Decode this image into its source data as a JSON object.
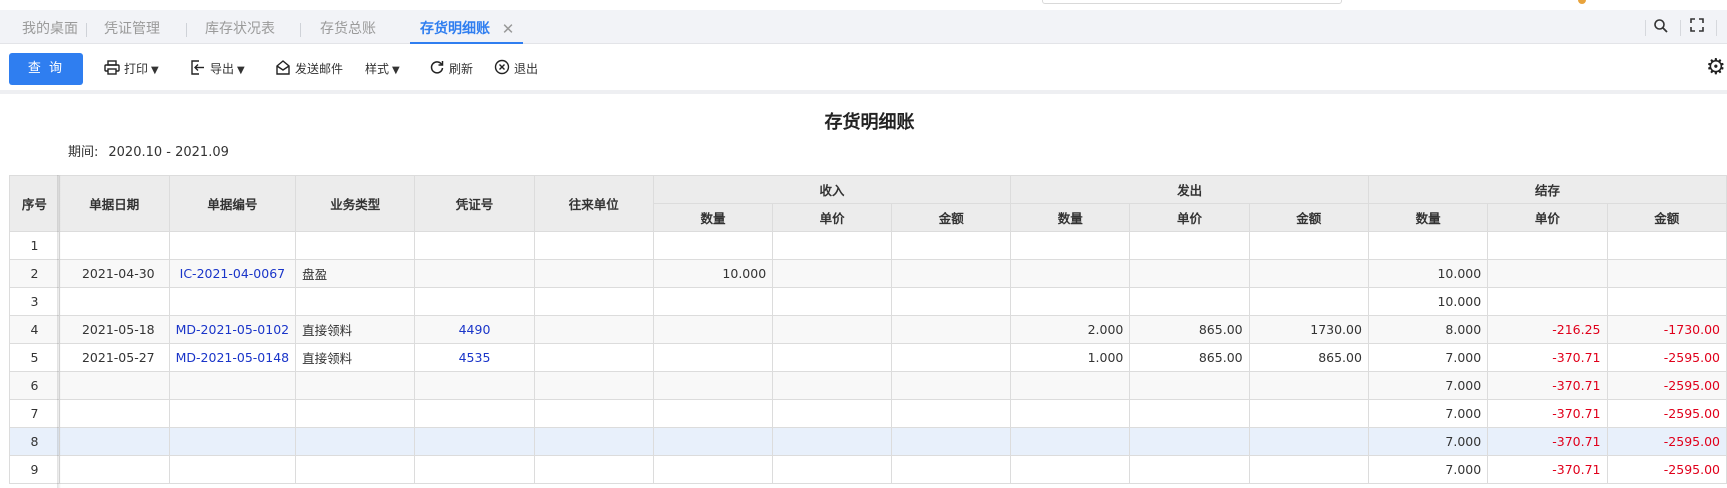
{
  "tabs": [
    {
      "label": "我的桌面"
    },
    {
      "label": "凭证管理"
    },
    {
      "label": "库存状况表"
    },
    {
      "label": "存货总账"
    },
    {
      "label": "存货明细账"
    }
  ],
  "toolbar": {
    "query": "查 询",
    "print": "打印",
    "export": "导出",
    "email": "发送邮件",
    "style": "样式",
    "refresh": "刷新",
    "exit": "退出"
  },
  "report": {
    "title": "存货明细账",
    "period_label": "期间:",
    "period_value": "2020.10 - 2021.09"
  },
  "table": {
    "headers": {
      "index": "序号",
      "date": "单据日期",
      "doc_no": "单据编号",
      "biz_type": "业务类型",
      "voucher": "凭证号",
      "partner": "往来单位",
      "in": "收入",
      "out": "发出",
      "balance": "结存",
      "qty": "数量",
      "price": "单价",
      "amount": "金额"
    },
    "rows": [
      {
        "idx": "1",
        "date": "",
        "doc": "",
        "type": "",
        "voucher": "",
        "partner": "",
        "in_qty": "",
        "in_price": "",
        "in_amt": "",
        "out_qty": "",
        "out_price": "",
        "out_amt": "",
        "bal_qty": "",
        "bal_price": "",
        "bal_amt": ""
      },
      {
        "idx": "2",
        "date": "2021-04-30",
        "doc": "IC-2021-04-0067",
        "type": "盘盈",
        "voucher": "",
        "partner": "",
        "in_qty": "10.000",
        "in_price": "",
        "in_amt": "",
        "out_qty": "",
        "out_price": "",
        "out_amt": "",
        "bal_qty": "10.000",
        "bal_price": "",
        "bal_amt": ""
      },
      {
        "idx": "3",
        "date": "",
        "doc": "",
        "type": "",
        "voucher": "",
        "partner": "",
        "in_qty": "",
        "in_price": "",
        "in_amt": "",
        "out_qty": "",
        "out_price": "",
        "out_amt": "",
        "bal_qty": "10.000",
        "bal_price": "",
        "bal_amt": ""
      },
      {
        "idx": "4",
        "date": "2021-05-18",
        "doc": "MD-2021-05-0102",
        "type": "直接领料",
        "voucher": "4490",
        "partner": "",
        "in_qty": "",
        "in_price": "",
        "in_amt": "",
        "out_qty": "2.000",
        "out_price": "865.00",
        "out_amt": "1730.00",
        "bal_qty": "8.000",
        "bal_price": "-216.25",
        "bal_amt": "-1730.00"
      },
      {
        "idx": "5",
        "date": "2021-05-27",
        "doc": "MD-2021-05-0148",
        "type": "直接领料",
        "voucher": "4535",
        "partner": "",
        "in_qty": "",
        "in_price": "",
        "in_amt": "",
        "out_qty": "1.000",
        "out_price": "865.00",
        "out_amt": "865.00",
        "bal_qty": "7.000",
        "bal_price": "-370.71",
        "bal_amt": "-2595.00"
      },
      {
        "idx": "6",
        "date": "",
        "doc": "",
        "type": "",
        "voucher": "",
        "partner": "",
        "in_qty": "",
        "in_price": "",
        "in_amt": "",
        "out_qty": "",
        "out_price": "",
        "out_amt": "",
        "bal_qty": "7.000",
        "bal_price": "-370.71",
        "bal_amt": "-2595.00"
      },
      {
        "idx": "7",
        "date": "",
        "doc": "",
        "type": "",
        "voucher": "",
        "partner": "",
        "in_qty": "",
        "in_price": "",
        "in_amt": "",
        "out_qty": "",
        "out_price": "",
        "out_amt": "",
        "bal_qty": "7.000",
        "bal_price": "-370.71",
        "bal_amt": "-2595.00"
      },
      {
        "idx": "8",
        "date": "",
        "doc": "",
        "type": "",
        "voucher": "",
        "partner": "",
        "in_qty": "",
        "in_price": "",
        "in_amt": "",
        "out_qty": "",
        "out_price": "",
        "out_amt": "",
        "bal_qty": "7.000",
        "bal_price": "-370.71",
        "bal_amt": "-2595.00"
      },
      {
        "idx": "9",
        "date": "",
        "doc": "",
        "type": "",
        "voucher": "",
        "partner": "",
        "in_qty": "",
        "in_price": "",
        "in_amt": "",
        "out_qty": "",
        "out_price": "",
        "out_amt": "",
        "bal_qty": "7.000",
        "bal_price": "-370.71",
        "bal_amt": "-2595.00"
      }
    ]
  },
  "colors": {
    "accent": "#2f7ef0",
    "link": "#1a35c9",
    "negative": "#e0001b",
    "header_bg": "#ececec",
    "highlight_row": "#e8f0fb"
  }
}
